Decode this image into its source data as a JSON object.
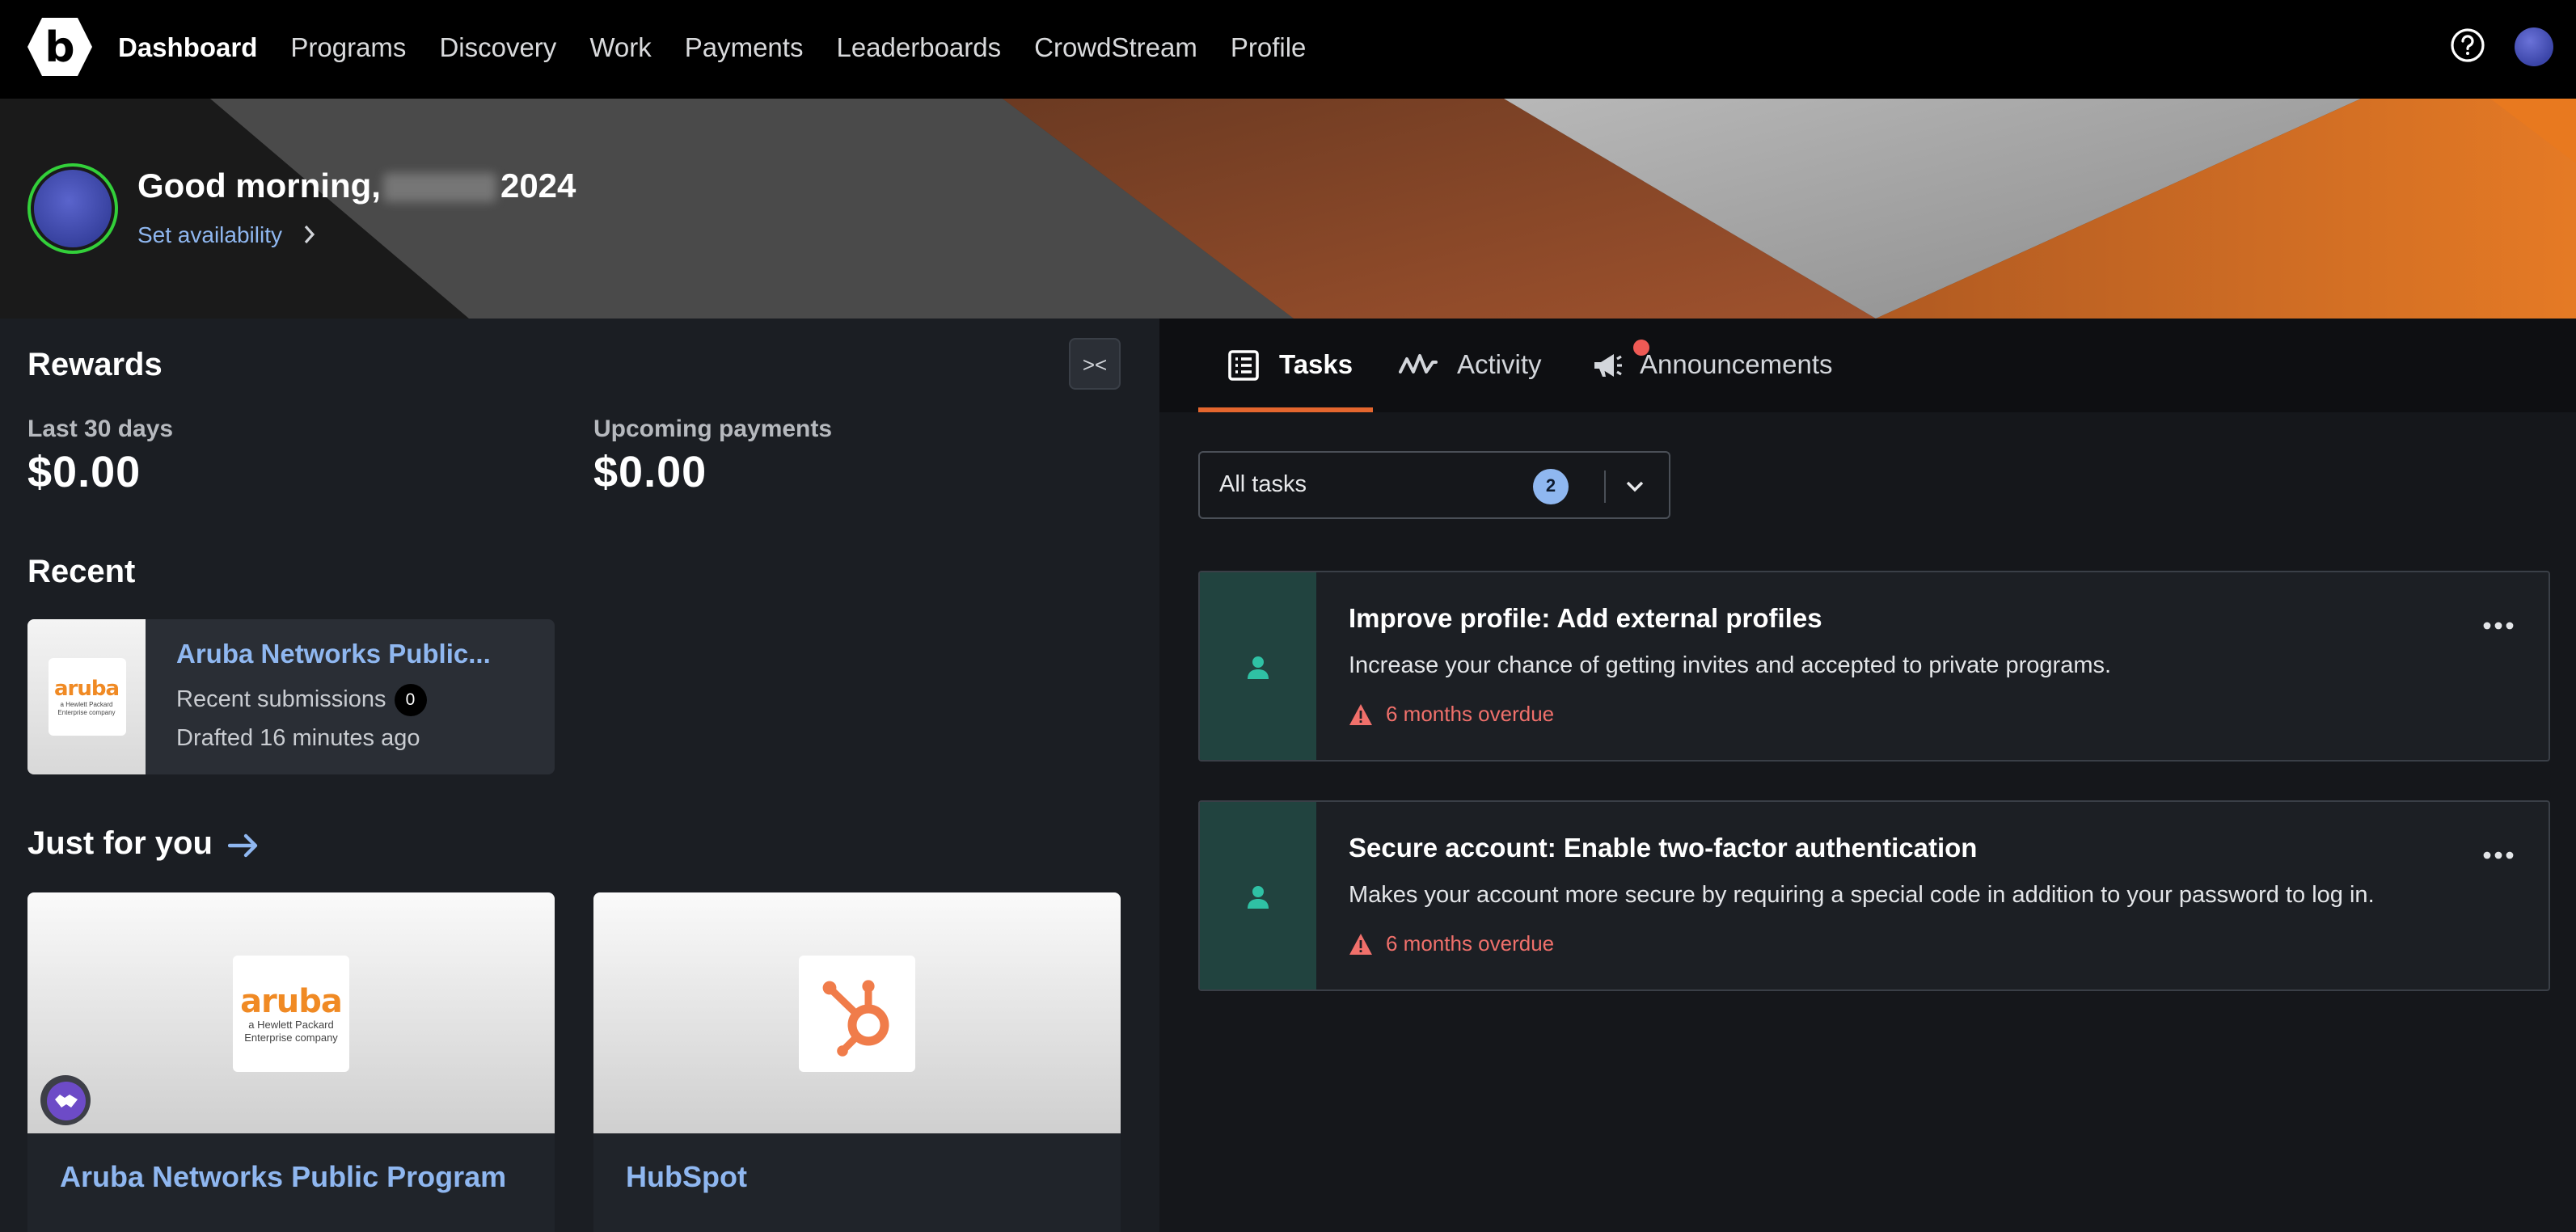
{
  "nav": {
    "logo_letter": "b",
    "items": [
      "Dashboard",
      "Programs",
      "Discovery",
      "Work",
      "Payments",
      "Leaderboards",
      "CrowdStream",
      "Profile"
    ],
    "active": "Dashboard"
  },
  "banner": {
    "greeting_prefix": "Good morning,",
    "greeting_suffix": "2024",
    "availability_label": "Set availability"
  },
  "rewards": {
    "title": "Rewards",
    "collapse_label": "><",
    "last30_label": "Last 30 days",
    "last30_value": "$0.00",
    "upcoming_label": "Upcoming payments",
    "upcoming_value": "$0.00"
  },
  "recent": {
    "title": "Recent",
    "item": {
      "name": "Aruba Networks Public...",
      "submissions_label": "Recent submissions",
      "submissions_count": "0",
      "drafted": "Drafted 16 minutes ago",
      "logo_word": "aruba",
      "logo_sub": "a Hewlett Packard Enterprise company"
    }
  },
  "just_for_you": {
    "title": "Just for you",
    "programs": [
      {
        "name": "Aruba Networks Public Program",
        "logo_word": "aruba",
        "logo_sub": "a Hewlett Packard Enterprise company"
      },
      {
        "name": "HubSpot"
      }
    ]
  },
  "tabs": {
    "items": [
      "Tasks",
      "Activity",
      "Announcements"
    ],
    "active": "Tasks"
  },
  "filter": {
    "label": "All tasks",
    "count": "2"
  },
  "tasks": [
    {
      "title": "Improve profile: Add external profiles",
      "description": "Increase your chance of getting invites and accepted to private programs.",
      "due": "6 months overdue"
    },
    {
      "title": "Secure account: Enable two-factor authentication",
      "description": "Makes your account more secure by requiring a special code in addition to your password to log in.",
      "due": "6 months overdue"
    }
  ],
  "colors": {
    "accent_orange": "#e4662e",
    "link_blue": "#8fb7f0",
    "overdue_red": "#f0706b",
    "task_side_teal": "#21433f",
    "online_green": "#33d03a"
  }
}
